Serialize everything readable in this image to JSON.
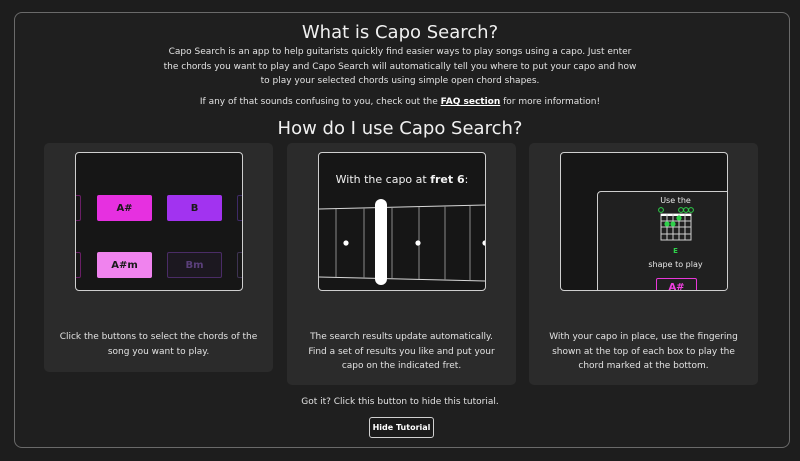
{
  "header": {
    "title": "What is Capo Search?",
    "intro": "Capo Search is an app to help guitarists quickly find easier ways to play songs using a capo. Just enter the chords you want to play and Capo Search will automatically tell you where to put your capo and how to play your selected chords using simple open chord shapes.",
    "faq_prefix": "If any of that sounds confusing to you, check out the ",
    "faq_link": "FAQ section",
    "faq_suffix": " for more information!",
    "subtitle": "How do I use Capo Search?"
  },
  "steps": [
    {
      "chords": [
        {
          "label": "A#",
          "state": "selected"
        },
        {
          "label": "B",
          "state": "selected"
        },
        {
          "label": "A#m",
          "state": "selected"
        },
        {
          "label": "Bm",
          "state": "unselected"
        }
      ],
      "text": "Click the buttons to select the chords of the song you want to play."
    },
    {
      "capo_prefix": "With the capo at ",
      "capo_fret": "fret 6",
      "capo_suffix": ":",
      "text": "The search results update automatically. Find a set of results you like and put your capo on the indicated fret."
    },
    {
      "use_the": "Use the",
      "shape": "E",
      "shape_to_play": "shape to play",
      "chord": "A#",
      "text": "With your capo in place, use the fingering shown at the top of each box to play the chord marked at the bottom."
    }
  ],
  "footer": {
    "got_it": "Got it? Click this button to hide this tutorial.",
    "hide_button": "Hide Tutorial"
  },
  "colors": {
    "chord_pink": "#e630e0",
    "chord_light_pink": "#f083ee",
    "chord_purple": "#a233f0",
    "fingering_green": "#2ed04a"
  }
}
